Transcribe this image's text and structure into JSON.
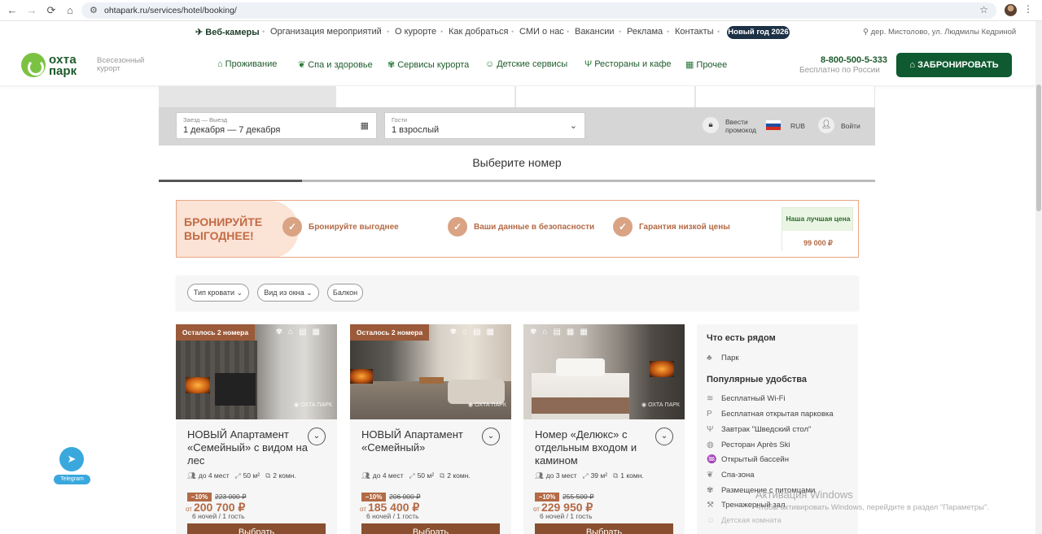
{
  "browser": {
    "url": "ohtapark.ru/services/hotel/booking/"
  },
  "topbar": {
    "webcams": "Веб-камеры",
    "links": [
      "Организация мероприятий",
      "О курорте",
      "Как добраться",
      "СМИ о нас",
      "Вакансии",
      "Реклама",
      "Контакты"
    ],
    "new_year": "Новый год 2026",
    "address": "дер. Мистолово, ул. Людмилы Кедриной"
  },
  "header": {
    "logo_line1": "охта",
    "logo_line2": "парк",
    "tagline": "Всесезонный курорт",
    "nav": [
      "Проживание",
      "Спа и здоровье",
      "Сервисы курорта",
      "Детские сервисы",
      "Рестораны и кафе",
      "Прочее"
    ],
    "phone": "8-800-500-5-333",
    "phone_note": "Бесплатно по России",
    "book_label": "ЗАБРОНИРОВАТЬ"
  },
  "search": {
    "dates_label": "Заезд — Выезд",
    "dates_value": "1 декабря — 7 декабря",
    "guests_label": "Гости",
    "guests_value": "1 взрослый",
    "promo_line1": "Ввести",
    "promo_line2": "промокод",
    "currency": "RUB",
    "login": "Войти"
  },
  "step_title": "Выберите номер",
  "step_progress": 0.2,
  "promo": {
    "headline": "БРОНИРУЙТЕ ВЫГОДНЕЕ!",
    "features": [
      "Бронируйте выгоднее",
      "Ваши данные в безопасности",
      "Гарантия низкой цены"
    ],
    "best_label": "Наша лучшая цена",
    "best_price": "99 000 ₽"
  },
  "filters": [
    "Тип кровати",
    "Вид из окна",
    "Балкон"
  ],
  "rooms": [
    {
      "badge": "Осталось 2 номера",
      "title": "НОВЫЙ Апартамент «Семейный» с видом на лес",
      "guests": "до 4 мест",
      "area": "50 м²",
      "rooms": "2 комн.",
      "discount": "−10%",
      "old_price": "223 000 ₽",
      "price_prefix": "от",
      "price": "200 700 ₽",
      "nights": "6 ночей / 1 гость",
      "select": "Выбрать"
    },
    {
      "badge": "Осталось 2 номера",
      "title": "НОВЫЙ Апартамент «Семейный»",
      "guests": "до 4 мест",
      "area": "50 м²",
      "rooms": "2 комн.",
      "discount": "−10%",
      "old_price": "206 000 ₽",
      "price_prefix": "от",
      "price": "185 400 ₽",
      "nights": "6 ночей / 1 гость",
      "select": "Выбрать"
    },
    {
      "badge": "",
      "title": "Номер «Делюкс» с отдельным входом и камином",
      "guests": "до 3 мест",
      "area": "39 м²",
      "rooms": "1 комн.",
      "discount": "−10%",
      "old_price": "255 500 ₽",
      "price_prefix": "от",
      "price": "229 950 ₽",
      "nights": "6 ночей / 1 гость",
      "select": "Выбрать"
    }
  ],
  "sidebar": {
    "nearby_title": "Что есть рядом",
    "nearby": [
      "Парк"
    ],
    "amenities_title": "Популярные удобства",
    "amenities": [
      "Бесплатный Wi-Fi",
      "Бесплатная открытая парковка",
      "Завтрак \"Шведский стол\"",
      "Ресторан Après Ski",
      "Открытый бассейн",
      "Спа-зона",
      "Размещение с питомцами",
      "Тренажерный зал",
      "Детская комната"
    ]
  },
  "telegram": "Telegram",
  "windows_watermark": {
    "title": "Активация Windows",
    "text": "Чтобы активировать Windows, перейдите в раздел \"Параметры\"."
  },
  "colors": {
    "brand_green": "#0f5a31",
    "accent_brown": "#b36a45",
    "button_brown": "#8a4f30"
  }
}
